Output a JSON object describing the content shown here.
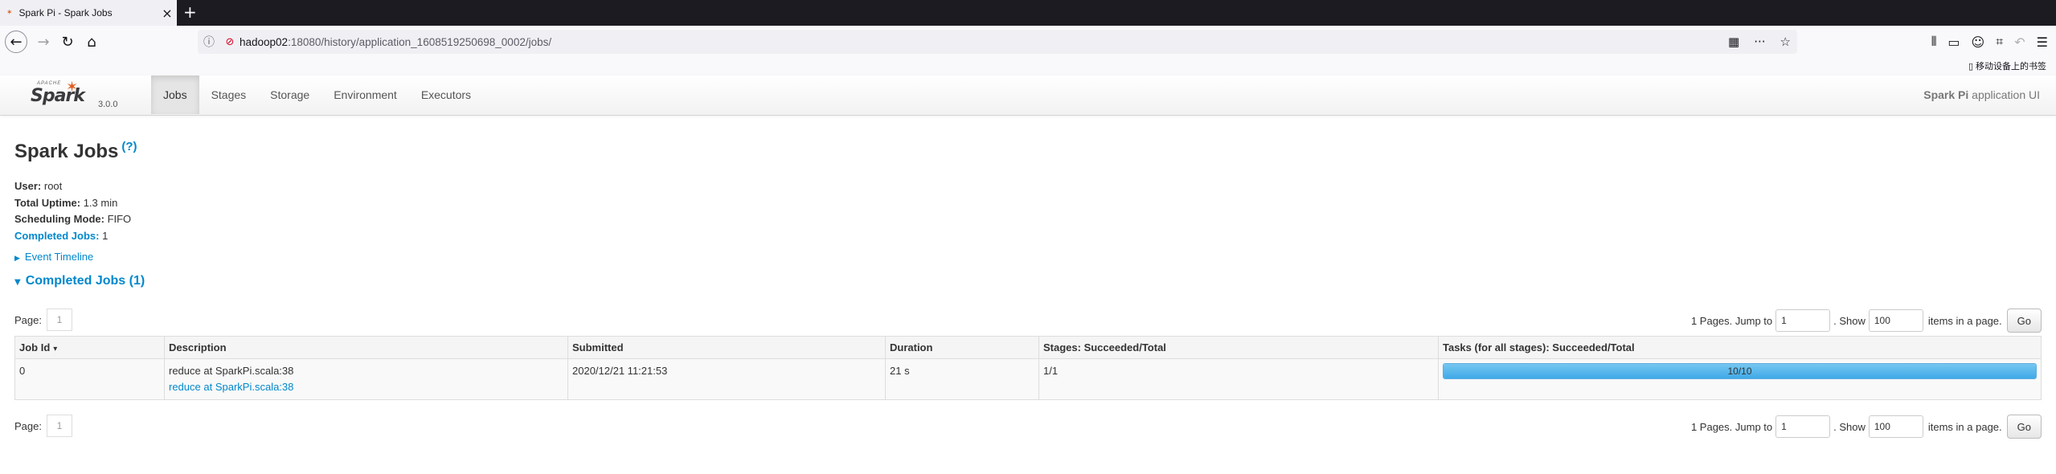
{
  "browser": {
    "tab_title": "Spark Pi - Spark Jobs",
    "tab_favicon": "spark",
    "url_host": "hadoop02",
    "url_rest": ":18080/history/application_1608519250698_0002/jobs/",
    "bookmark_mobile": "移动设备上的书签"
  },
  "spark_nav": {
    "logo_apache": "APACHE",
    "logo_text": "Spark",
    "version": "3.0.0",
    "tabs": [
      {
        "label": "Jobs",
        "active": true
      },
      {
        "label": "Stages"
      },
      {
        "label": "Storage"
      },
      {
        "label": "Environment"
      },
      {
        "label": "Executors"
      }
    ],
    "app_name": "Spark Pi",
    "app_suffix": " application UI"
  },
  "page": {
    "title": "Spark Jobs",
    "help": "(?)",
    "summary": {
      "user_label": "User:",
      "user_value": " root",
      "uptime_label": "Total Uptime:",
      "uptime_value": " 1.3 min",
      "mode_label": "Scheduling Mode:",
      "mode_value": " FIFO",
      "completed_label": "Completed Jobs:",
      "completed_value": " 1"
    },
    "event_timeline": "Event Timeline",
    "completed_section": "Completed Jobs (1)"
  },
  "pager": {
    "page_label": "Page:",
    "page_value": "1",
    "jump_prefix": "1 Pages. Jump to",
    "jump_value": "1",
    "show_label": ". Show",
    "show_value": "100",
    "items_suffix": "items in a page.",
    "go": "Go"
  },
  "table": {
    "headers": {
      "job_id": "Job Id",
      "description": "Description",
      "submitted": "Submitted",
      "duration": "Duration",
      "stages": "Stages: Succeeded/Total",
      "tasks": "Tasks (for all stages): Succeeded/Total"
    },
    "rows": [
      {
        "job_id": "0",
        "desc_main": "reduce at SparkPi.scala:38",
        "desc_link": "reduce at SparkPi.scala:38",
        "submitted": "2020/12/21 11:21:53",
        "duration": "21 s",
        "stages": "1/1",
        "tasks_label": "10/10",
        "tasks_fraction": 1.0
      }
    ]
  },
  "colors": {
    "link": "#0088cc",
    "progress": "#3fa9e8"
  }
}
